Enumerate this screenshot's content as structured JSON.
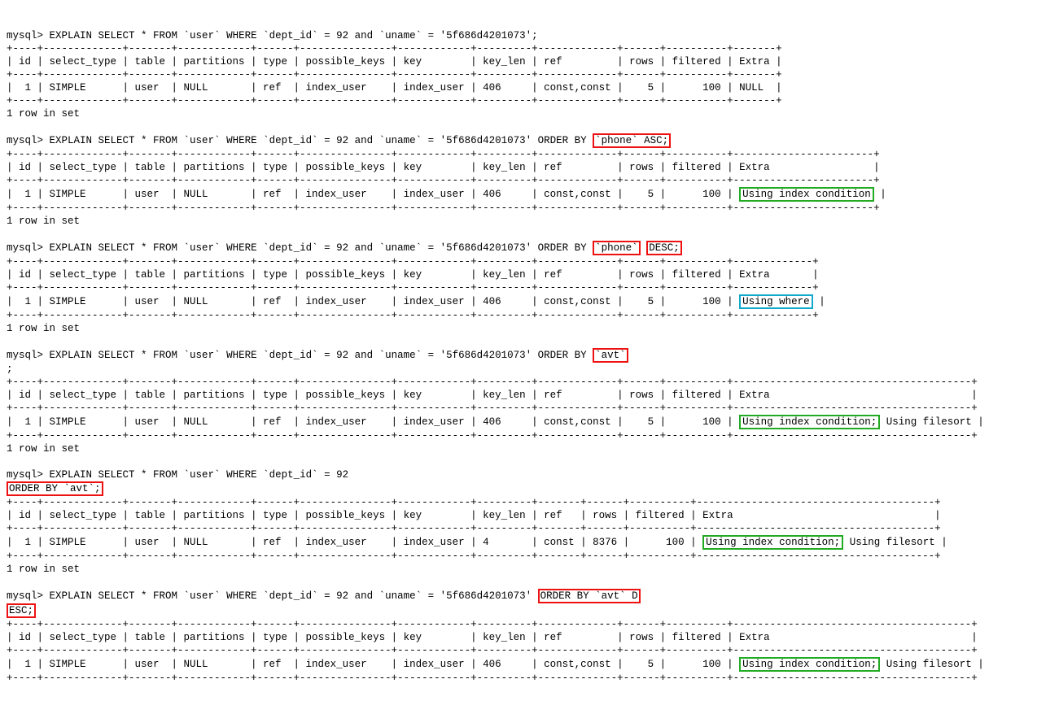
{
  "prompt": "mysql>",
  "base_explain": "EXPLAIN SELECT * FROM `user` WHERE `dept_id` = 92 and `uname` = '5f686d4201073'",
  "base_explain_short": "EXPLAIN SELECT * FROM `user` WHERE `dept_id` = 92",
  "semicolon": ";",
  "orderby_phone_asc_pre": " ORDER BY ",
  "orderby_phone_asc_hl": "`phone` ASC;",
  "orderby_phone_pre": " ORDER BY ",
  "orderby_phone_hl": "`phone`",
  "orderby_desc_hl": "DESC;",
  "orderby_avt_pre": " ORDER BY ",
  "orderby_avt_hl": "`avt`",
  "orderby_avt_desc_hl": "ORDER BY `avt` D",
  "orderby_avt_shortline_hl": "ORDER BY `avt`;",
  "esc_hl": "ESC;",
  "rowset": "1 row in set",
  "sep_full": "+----+-------------+-------+------------+------+---------------+------------+---------+-------------+------+----------+-------+",
  "hdr_full": "| id | select_type | table | partitions | type | possible_keys | key        | key_len | ref         | rows | filtered | Extra |",
  "row_full_null": "|  1 | SIMPLE      | user  | NULL       | ref  | index_user    | index_user | 406     | const,const |    5 |      100 | NULL  |",
  "sep_uic": "+----+-------------+-------+------------+------+---------------+------------+---------+-------------+------+----------+-----------------------+",
  "hdr_uic": "| id | select_type | table | partitions | type | possible_keys | key        | key_len | ref         | rows | filtered | Extra                 |",
  "row_uic_pre": "|  1 | SIMPLE      | user  | NULL       | ref  | index_user    | index_user | 406     | const,const |    5 |      100 |",
  "row_uic_extra": "Using index condition",
  "row_uic_post": "|",
  "sep_uw": "+----+-------------+-------+------------+------+---------------+------------+---------+-------------+------+----------+-------------+",
  "hdr_uw": "| id | select_type | table | partitions | type | possible_keys | key        | key_len | ref         | rows | filtered | Extra       |",
  "row_uw_pre": "|  1 | SIMPLE      | user  | NULL       | ref  | index_user    | index_user | 406     | const,const |    5 |      100 |",
  "row_uw_extra": "Using where",
  "row_uw_post": "|",
  "sep_uicfs": "+----+-------------+-------+------------+------+---------------+------------+---------+-------------+------+----------+---------------------------------------+",
  "hdr_uicfs": "| id | select_type | table | partitions | type | possible_keys | key        | key_len | ref         | rows | filtered | Extra                                 |",
  "row_uicfs_pre": "|  1 | SIMPLE      | user  | NULL       | ref  | index_user    | index_user | 406     | const,const |    5 |      100 |",
  "row_uicfs_extra1": "Using index condition;",
  "row_uicfs_extra2": " Using filesort |",
  "sep_short": "+----+-------------+-------+------------+------+---------------+------------+---------+-------+------+----------+---------------------------------------+",
  "hdr_short": "| id | select_type | table | partitions | type | possible_keys | key        | key_len | ref   | rows | filtered | Extra                                 |",
  "row_short_pre": "|  1 | SIMPLE      | user  | NULL       | ref  | index_user    | index_user | 4       | const | 8376 |      100 |",
  "row_short_extra1": "Using index condition;",
  "row_short_extra2": " Using filesort |",
  "chart_data": {
    "type": "table",
    "title": "MySQL EXPLAIN output comparison for ORDER BY variants",
    "columns": [
      "id",
      "select_type",
      "table",
      "partitions",
      "type",
      "possible_keys",
      "key",
      "key_len",
      "ref",
      "rows",
      "filtered",
      "Extra"
    ],
    "rows": [
      {
        "query": "WHERE dept_id=92 AND uname='5f686d4201073'",
        "id": 1,
        "select_type": "SIMPLE",
        "table": "user",
        "partitions": "NULL",
        "type": "ref",
        "possible_keys": "index_user",
        "key": "index_user",
        "key_len": 406,
        "ref": "const,const",
        "rows": 5,
        "filtered": 100,
        "Extra": "NULL"
      },
      {
        "query": "... ORDER BY `phone` ASC",
        "id": 1,
        "select_type": "SIMPLE",
        "table": "user",
        "partitions": "NULL",
        "type": "ref",
        "possible_keys": "index_user",
        "key": "index_user",
        "key_len": 406,
        "ref": "const,const",
        "rows": 5,
        "filtered": 100,
        "Extra": "Using index condition"
      },
      {
        "query": "... ORDER BY `phone` DESC",
        "id": 1,
        "select_type": "SIMPLE",
        "table": "user",
        "partitions": "NULL",
        "type": "ref",
        "possible_keys": "index_user",
        "key": "index_user",
        "key_len": 406,
        "ref": "const,const",
        "rows": 5,
        "filtered": 100,
        "Extra": "Using where"
      },
      {
        "query": "... ORDER BY `avt`",
        "id": 1,
        "select_type": "SIMPLE",
        "table": "user",
        "partitions": "NULL",
        "type": "ref",
        "possible_keys": "index_user",
        "key": "index_user",
        "key_len": 406,
        "ref": "const,const",
        "rows": 5,
        "filtered": 100,
        "Extra": "Using index condition; Using filesort"
      },
      {
        "query": "WHERE dept_id=92 ORDER BY `avt`",
        "id": 1,
        "select_type": "SIMPLE",
        "table": "user",
        "partitions": "NULL",
        "type": "ref",
        "possible_keys": "index_user",
        "key": "index_user",
        "key_len": 4,
        "ref": "const",
        "rows": 8376,
        "filtered": 100,
        "Extra": "Using index condition; Using filesort"
      },
      {
        "query": "... ORDER BY `avt` DESC",
        "id": 1,
        "select_type": "SIMPLE",
        "table": "user",
        "partitions": "NULL",
        "type": "ref",
        "possible_keys": "index_user",
        "key": "index_user",
        "key_len": 406,
        "ref": "const,const",
        "rows": 5,
        "filtered": 100,
        "Extra": "Using index condition; Using filesort"
      }
    ]
  }
}
